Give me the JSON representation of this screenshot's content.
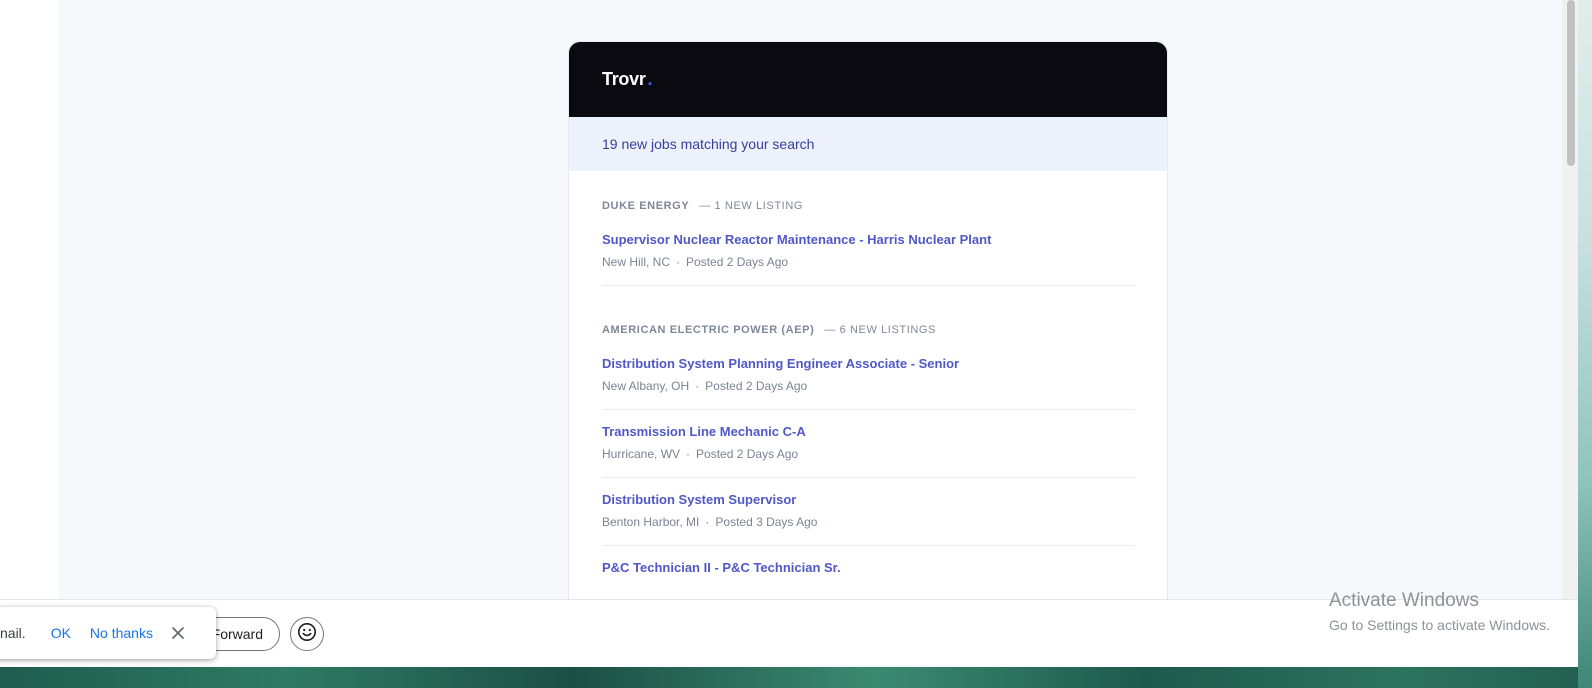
{
  "email": {
    "brand": {
      "name": "Trovr",
      "dot": "."
    },
    "banner": "19 new jobs matching your search",
    "companies": [
      {
        "name": "DUKE ENERGY",
        "count": "— 1 NEW LISTING",
        "jobs": [
          {
            "title": "Supervisor Nuclear Reactor Maintenance - Harris Nuclear Plant",
            "location": "New Hill, NC",
            "posted": "Posted 2 Days Ago"
          }
        ]
      },
      {
        "name": "AMERICAN ELECTRIC POWER (AEP)",
        "count": "— 6 NEW LISTINGS",
        "jobs": [
          {
            "title": "Distribution System Planning Engineer Associate - Senior",
            "location": "New Albany, OH",
            "posted": "Posted 2 Days Ago"
          },
          {
            "title": "Transmission Line Mechanic C-A",
            "location": "Hurricane, WV",
            "posted": "Posted 2 Days Ago"
          },
          {
            "title": "Distribution System Supervisor",
            "location": "Benton Harbor, MI",
            "posted": "Posted 3 Days Ago"
          },
          {
            "title": "P&C Technician II - P&C Technician Sr.",
            "location": "",
            "posted": ""
          }
        ]
      }
    ],
    "meta_separator": "·"
  },
  "toolbar": {
    "forward_label": "Forward"
  },
  "toast": {
    "text": "nail.",
    "ok": "OK",
    "no_thanks": "No thanks"
  },
  "watermark": {
    "title": "Activate Windows",
    "subtitle": "Go to Settings to activate Windows."
  },
  "icons": {
    "close": "close-icon",
    "emoji": "emoji-icon"
  }
}
